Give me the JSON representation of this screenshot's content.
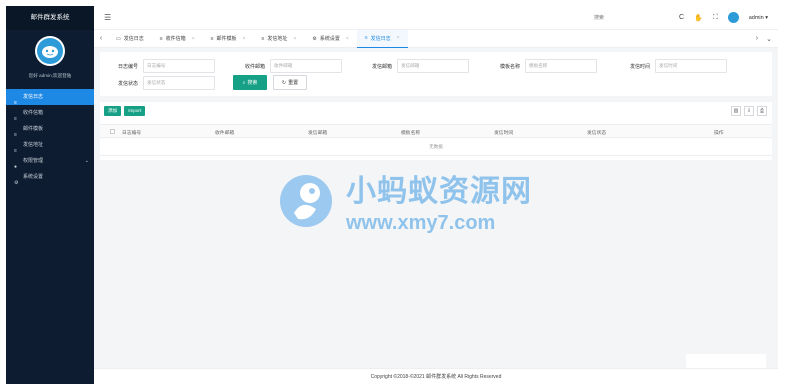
{
  "app": {
    "title": "邮件群发系统",
    "user_caption": "您好 admin,欢迎登陆"
  },
  "sidebar": {
    "items": [
      {
        "label": "发信日志",
        "icon": "list-icon",
        "active": true
      },
      {
        "label": "收件信箱",
        "icon": "list-icon"
      },
      {
        "label": "邮件模板",
        "icon": "list-icon"
      },
      {
        "label": "发信地址",
        "icon": "list-icon"
      },
      {
        "label": "权限管理",
        "icon": "users-icon",
        "has_children": true
      },
      {
        "label": "系统设置",
        "icon": "gear-icon"
      }
    ]
  },
  "topbar": {
    "search_label": "搜索",
    "refresh_icon": "C",
    "user_name": "admin"
  },
  "tabs": [
    {
      "label": "发信日志",
      "icon": "monitor-icon"
    },
    {
      "label": "收件信箱",
      "icon": "list-icon",
      "closable": true
    },
    {
      "label": "邮件模板",
      "icon": "list-icon",
      "closable": true
    },
    {
      "label": "发信地址",
      "icon": "list-icon",
      "closable": true
    },
    {
      "label": "系统设置",
      "icon": "gear-icon",
      "closable": true
    },
    {
      "label": "发信日志",
      "icon": "list-icon",
      "closable": true,
      "active": true
    }
  ],
  "search": {
    "fields": [
      {
        "label": "日志编号",
        "placeholder": "日志编号"
      },
      {
        "label": "收件邮箱",
        "placeholder": "收件邮箱"
      },
      {
        "label": "发信邮箱",
        "placeholder": "发信邮箱"
      },
      {
        "label": "模板名称",
        "placeholder": "模板名称"
      },
      {
        "label": "发信时间",
        "placeholder": "发信时间"
      },
      {
        "label": "发信状态",
        "placeholder": "发信状态"
      }
    ],
    "search_button": "搜索",
    "reset_button": "重置"
  },
  "table": {
    "toolbar": {
      "add": "添加",
      "import": "Import"
    },
    "columns": [
      "日志编号",
      "收件邮箱",
      "发信邮箱",
      "模板名称",
      "发信时间",
      "发信状态",
      "操作"
    ],
    "empty_text": "无数据"
  },
  "footer": {
    "text": "Copyright ©2018-©2021 邮件群发系统 All Rights Reserved"
  },
  "watermark": {
    "title": "小蚂蚁资源网",
    "url": "www.xmy7.com"
  },
  "colors": {
    "sidebar": "#0d1c30",
    "accent": "#1e88e5",
    "button": "#16a085"
  }
}
